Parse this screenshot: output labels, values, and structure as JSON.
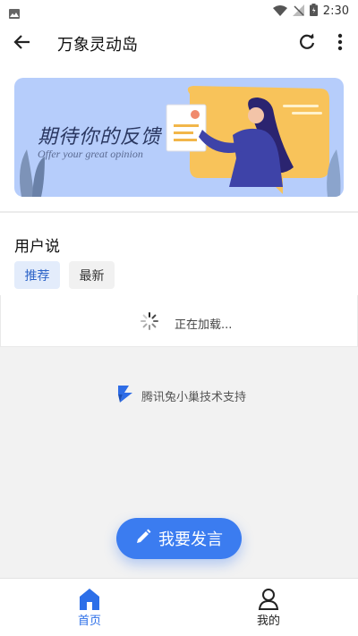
{
  "status_bar": {
    "time": "2:30"
  },
  "app_bar": {
    "title": "万象灵动岛"
  },
  "banner": {
    "title": "期待你的反馈",
    "subtitle": "Offer your great opinion"
  },
  "feed": {
    "section_title": "用户说",
    "tabs": [
      {
        "label": "推荐",
        "active": true
      },
      {
        "label": "最新",
        "active": false
      }
    ],
    "loading_text": "正在加载..."
  },
  "footer": {
    "support_text": "腾讯兔小巢技术支持"
  },
  "fab": {
    "label": "我要发言"
  },
  "bottom_nav": {
    "items": [
      {
        "label": "首页",
        "icon": "home-icon",
        "active": true
      },
      {
        "label": "我的",
        "icon": "user-icon",
        "active": false
      }
    ]
  },
  "colors": {
    "accent": "#3b7cf0",
    "active_tab_bg": "#e3ecfb",
    "banner_bg": "#b6cdfb"
  }
}
